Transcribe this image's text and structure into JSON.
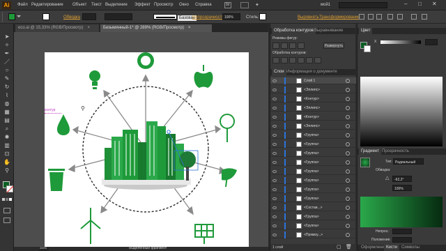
{
  "app": {
    "logo": "Ai",
    "workspace": "мой1"
  },
  "menu": [
    "Файл",
    "Редактирование",
    "Объект",
    "Текст",
    "Выделение",
    "Эффект",
    "Просмотр",
    "Окно",
    "Справка"
  ],
  "control": {
    "stroke_label": "Обводка",
    "brush_label": "Базовая",
    "opacity_label": "Непрозрачность",
    "opacity_value": "100%",
    "style_label": "Стиль:",
    "align_label": "Выровнять",
    "transform_label": "Трансформирование"
  },
  "tabs": [
    {
      "label": "eco.ai @ 15,33% (RGB/Просмотр)"
    },
    {
      "label": "Безымянный-1* @ 289% (RGB/Просмотр)"
    }
  ],
  "canvas": {
    "annotation": "контур",
    "selection_label": "Выделенный фрагмент",
    "zoom": "289%"
  },
  "pathfinder": {
    "tabs": [
      "Обработка контуров",
      "Выравнивание"
    ],
    "shape_modes": "Режимы фигур:",
    "expand": "Развернуть",
    "pathfinders": "Обработка контуров:"
  },
  "layers": {
    "tabs": [
      "Слои",
      "Информация о документе"
    ],
    "rows": [
      "Слой 1",
      "<Эллипс>",
      "<Контур>",
      "<Эллипс>",
      "<Контур>",
      "<Эллипс>",
      "<Группа>",
      "<Группа>",
      "<Группа>",
      "<Группа>",
      "<Группа>",
      "<Группа>",
      "<Группа>",
      "<Группа>",
      "<Состав...>",
      "<Группа>",
      "<Группа>",
      "<Прямоу...>"
    ],
    "footer": "1 слой"
  },
  "color": {
    "tab": "Цвет",
    "x_label": "X"
  },
  "gradient": {
    "tabs": [
      "Градиент",
      "Прозрачность"
    ],
    "type_label": "Тип:",
    "type_value": "Радиальный",
    "stroke_label": "Обводка:",
    "angle_value": "-62,2°",
    "aspect_value": "100%",
    "opacity_label": "Непроз.:",
    "location_label": "Положение:"
  },
  "bottom_tabs": [
    "Оформление",
    "Кисти",
    "Символы"
  ],
  "colors": {
    "accent": "#2c73d9",
    "green": "#1e9a3a",
    "dark_green": "#0b5e22"
  }
}
